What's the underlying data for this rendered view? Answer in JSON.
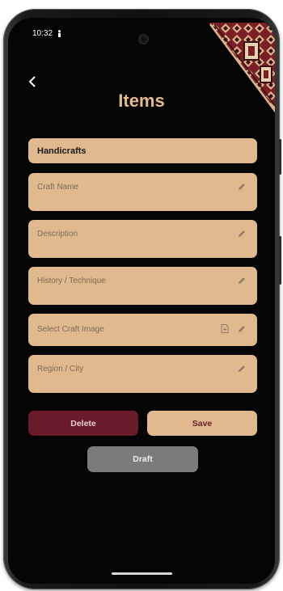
{
  "status_bar": {
    "time": "10:32",
    "icons": [
      "person-icon",
      "wifi-icon",
      "signal-icon",
      "battery-icon"
    ]
  },
  "header": {
    "back_icon": "chevron-left-icon",
    "title": "Items"
  },
  "form": {
    "category": "Handicrafts",
    "fields": [
      {
        "label": "Craft Name",
        "icon": "pencil-icon"
      },
      {
        "label": "Description",
        "icon": "pencil-icon"
      },
      {
        "label": "History / Technique",
        "icon": "pencil-icon"
      },
      {
        "label": "Select Craft Image",
        "icons": [
          "file-add-icon",
          "pencil-icon"
        ]
      },
      {
        "label": "Region / City",
        "icon": "pencil-icon"
      }
    ]
  },
  "actions": {
    "delete_label": "Delete",
    "save_label": "Save",
    "draft_label": "Draft"
  },
  "colors": {
    "accent": "#e0b98f",
    "title": "#e4bb8a",
    "delete": "#6a1b2a",
    "draft": "#7b7b7b",
    "background": "#050505"
  }
}
